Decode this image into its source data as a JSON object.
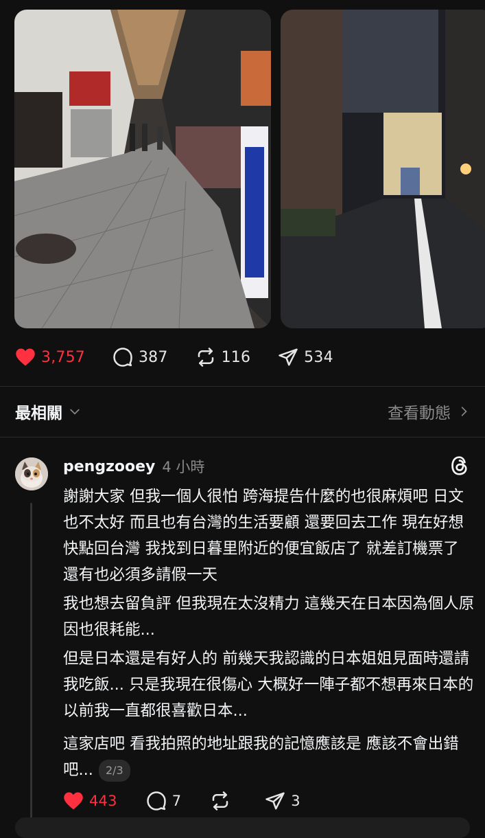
{
  "post": {
    "stats": {
      "likes": "3,757",
      "replies": "387",
      "reposts": "116",
      "shares": "534"
    }
  },
  "sort": {
    "label": "最相關",
    "view_activity": "查看動態"
  },
  "comment": {
    "username": "pengzooey",
    "time": "4 小時",
    "paragraphs": [
      "謝謝大家 但我一個人很怕 跨海提告什麼的也很麻煩吧 日文也不太好 而且也有台灣的生活要顧 還要回去工作 現在好想快點回台灣 我找到日暮里附近的便宜飯店了 就差訂機票了 還有也必須多請假一天",
      "我也想去留負評 但我現在太沒精力 這幾天在日本因為個人原因也很耗能...",
      "但是日本還是有好人的 前幾天我認識的日本姐姐見面時還請我吃飯... 只是我現在很傷心 大概好一陣子都不想再來日本的 以前我一直都很喜歡日本...",
      "這家店吧 看我拍照的地址跟我的記憶應該是 應該不會出錯吧..."
    ],
    "page_indicator": "2/3",
    "stats": {
      "likes": "443",
      "replies": "7",
      "shares": "3"
    }
  },
  "colors": {
    "background": "#101010",
    "like_red": "#ff3040",
    "muted": "#8a8a8a"
  },
  "icons": [
    "heart-icon",
    "comment-icon",
    "repost-icon",
    "share-icon",
    "chevron-down-icon",
    "chevron-right-icon",
    "threads-logo-icon"
  ]
}
